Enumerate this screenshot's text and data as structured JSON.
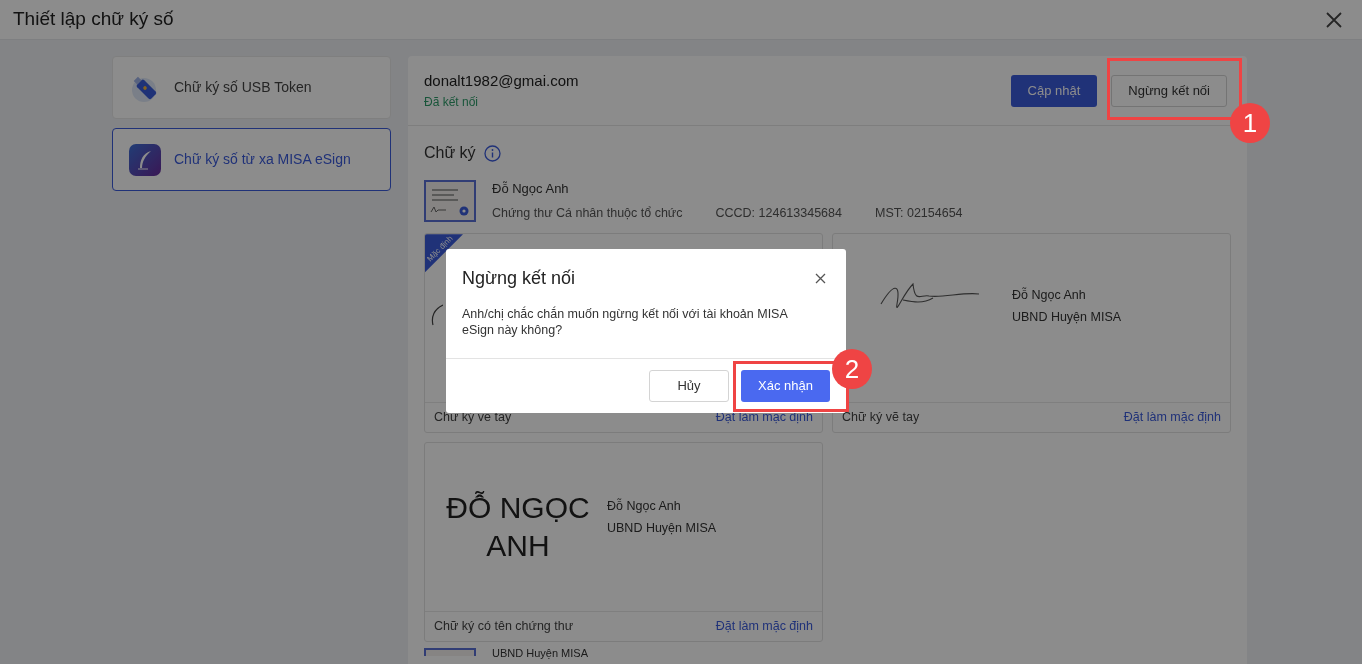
{
  "window": {
    "title": "Thiết lập chữ ký số"
  },
  "sidebar": {
    "items": [
      {
        "label": "Chữ ký số USB Token",
        "selected": false,
        "kind": "usb"
      },
      {
        "label": "Chữ ký số từ xa MISA eSign",
        "selected": true,
        "kind": "esign"
      }
    ]
  },
  "account": {
    "email": "donalt1982@gmai.com",
    "status": "Đã kết nối",
    "buttons": [
      {
        "label": "Cập nhật",
        "kind": "primary"
      },
      {
        "label": "Ngừng kết nối",
        "kind": "secondary"
      }
    ]
  },
  "signatures": {
    "title": "Chữ ký",
    "certificate": {
      "name": "Đỗ Ngọc Anh",
      "type": "Chứng thư Cá nhân thuộc tổ chức",
      "id": "CCCD: 124613345684",
      "tax": "MST: 02154654"
    },
    "cards": [
      {
        "kind": "handwritten",
        "badge": "Mặc định",
        "label": "Chữ ký vẽ tay",
        "action": "Đặt làm mặc định"
      },
      {
        "kind": "handwritten",
        "lines": [
          "Đỗ Ngọc Anh",
          "UBND Huyện MISA"
        ],
        "label": "Chữ ký vẽ tay",
        "action": "Đặt làm mặc định"
      },
      {
        "kind": "named",
        "stamp": "ĐỖ NGỌC ANH",
        "lines": [
          "Đỗ Ngọc Anh",
          "UBND Huyện MISA"
        ],
        "label": "Chữ ký có tên chứng thư",
        "action": "Đặt làm mặc định"
      }
    ]
  },
  "next_certificate": {
    "name": "UBND Huyện MISA"
  },
  "dialog": {
    "title": "Ngừng kết nối",
    "message": "Anh/chị chắc chắn muốn ngừng kết nối với tài khoản MISA eSign này không?",
    "buttons": [
      {
        "label": "Hủy",
        "kind": "secondary"
      },
      {
        "label": "Xác nhận",
        "kind": "primary"
      }
    ]
  },
  "callouts": [
    {
      "label": "1"
    },
    {
      "label": "2"
    }
  ]
}
